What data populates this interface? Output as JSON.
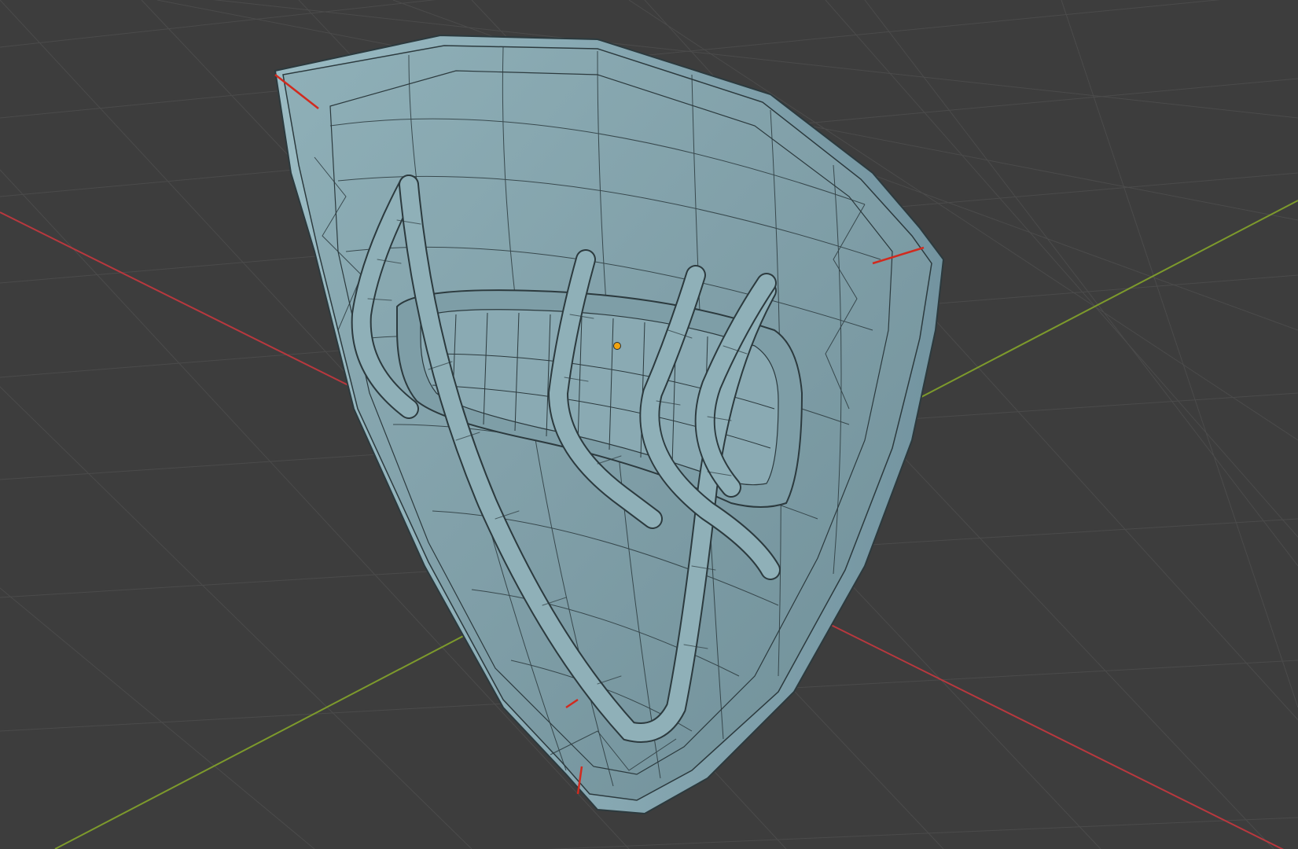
{
  "viewport": {
    "background": "#3d3d3d",
    "grid_color": "#4b4b4b",
    "axis_x_color": "#b8383e",
    "axis_y_color": "#7d9a2c",
    "object_color": "#86a6ae",
    "object_shadow": "#6d8e97",
    "wire_color": "#2c3a3e",
    "seam_color": "#d12a1e",
    "origin_color": "#f2a30f"
  }
}
